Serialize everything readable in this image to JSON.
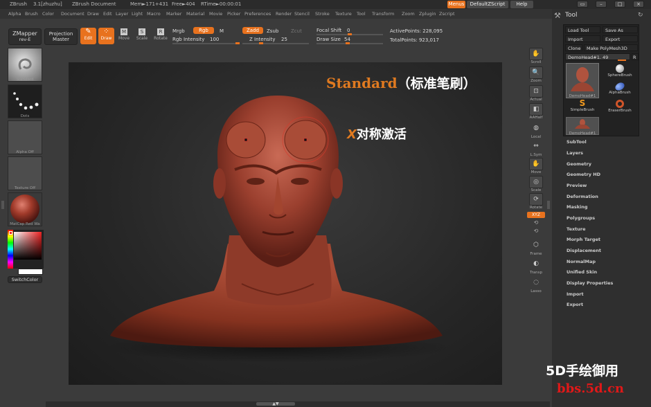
{
  "titlebar": {
    "app": "ZBrush",
    "version_user": "3.1[zhuzhu]",
    "document": "ZBrush Document",
    "mem": "Mem►171+431",
    "free": "Free►404",
    "rtime": "RTime►00:00:01",
    "menus_btn": "Menus",
    "script_btn": "DefaultZScript",
    "help_btn": "Help"
  },
  "menubar": [
    "Alpha",
    "Brush",
    "Color",
    "Document",
    "Draw",
    "Edit",
    "Layer",
    "Light",
    "Macro",
    "Marker",
    "Material",
    "Movie",
    "Picker",
    "Preferences",
    "Render",
    "Stencil",
    "Stroke",
    "Texture",
    "Tool",
    "Transform",
    "Zoom",
    "Zplugin",
    "Zscript"
  ],
  "shelf": {
    "zmapper": "ZMapper",
    "zmapper_sub": "rev-E",
    "projection": "Projection",
    "projection_sub": "Master",
    "edit": "Edit",
    "draw": "Draw",
    "move": "Move",
    "scale": "Scale",
    "rotate": "Rotate",
    "mrgb": "Mrgb",
    "rgb": "Rgb",
    "m": "M",
    "rgb_intensity": "Rgb Intensity",
    "rgb_intensity_val": "100",
    "zadd": "Zadd",
    "zsub": "Zsub",
    "zcut": "Zcut",
    "z_intensity": "Z Intensity",
    "z_intensity_val": "25",
    "focal_shift": "Focal Shift",
    "focal_shift_val": "0",
    "draw_size": "Draw Size",
    "draw_size_val": "54",
    "active_points": "ActivePoints: 228,095",
    "total_points": "TotalPoints: 923,017"
  },
  "leftpanel": {
    "standard": "Standard",
    "dots": "Dots",
    "alpha_off": "Alpha Off",
    "texture_off": "Texture Off",
    "matcap": "MatCap Red Wa",
    "switch_color": "SwitchColor"
  },
  "viewport": {
    "title_en": "Standard",
    "title_cn": "（标准笔刷）",
    "sym_x": "X",
    "sym_text": "对称激活"
  },
  "rightshelf": [
    "Scroll",
    "Zoom",
    "Actual",
    "AAHalf",
    "Local",
    "L.Sym",
    "Move",
    "Scale",
    "Rotate",
    "XYZ",
    "",
    "Frame",
    "Transp",
    "Lasso"
  ],
  "toolpanel": {
    "title": "Tool",
    "load_tool": "Load Tool",
    "save_as": "Save As",
    "import": "Import",
    "export": "Export",
    "clone": "Clone",
    "make_polymesh": "Make PolyMesh3D",
    "current_tool": "DemoHead#1. 49",
    "r": "R",
    "tools": [
      {
        "name": "DemoHead#1"
      },
      {
        "name": "SphereBrush"
      },
      {
        "name": "AlphaBrush"
      },
      {
        "name": "SimpleBrush"
      },
      {
        "name": "EraserBrush"
      },
      {
        "name": "DemoHead#1"
      }
    ],
    "menu": [
      "SubTool",
      "Layers",
      "Geometry",
      "Geometry HD",
      "Preview",
      "Deformation",
      "Masking",
      "Polygroups",
      "Texture",
      "Morph Target",
      "Displacement",
      "NormalMap",
      "Unified Skin",
      "Display Properties",
      "Import",
      "Export"
    ]
  },
  "watermark": {
    "line1": "5D手绘御用",
    "line2": "bbs.5d.cn"
  }
}
